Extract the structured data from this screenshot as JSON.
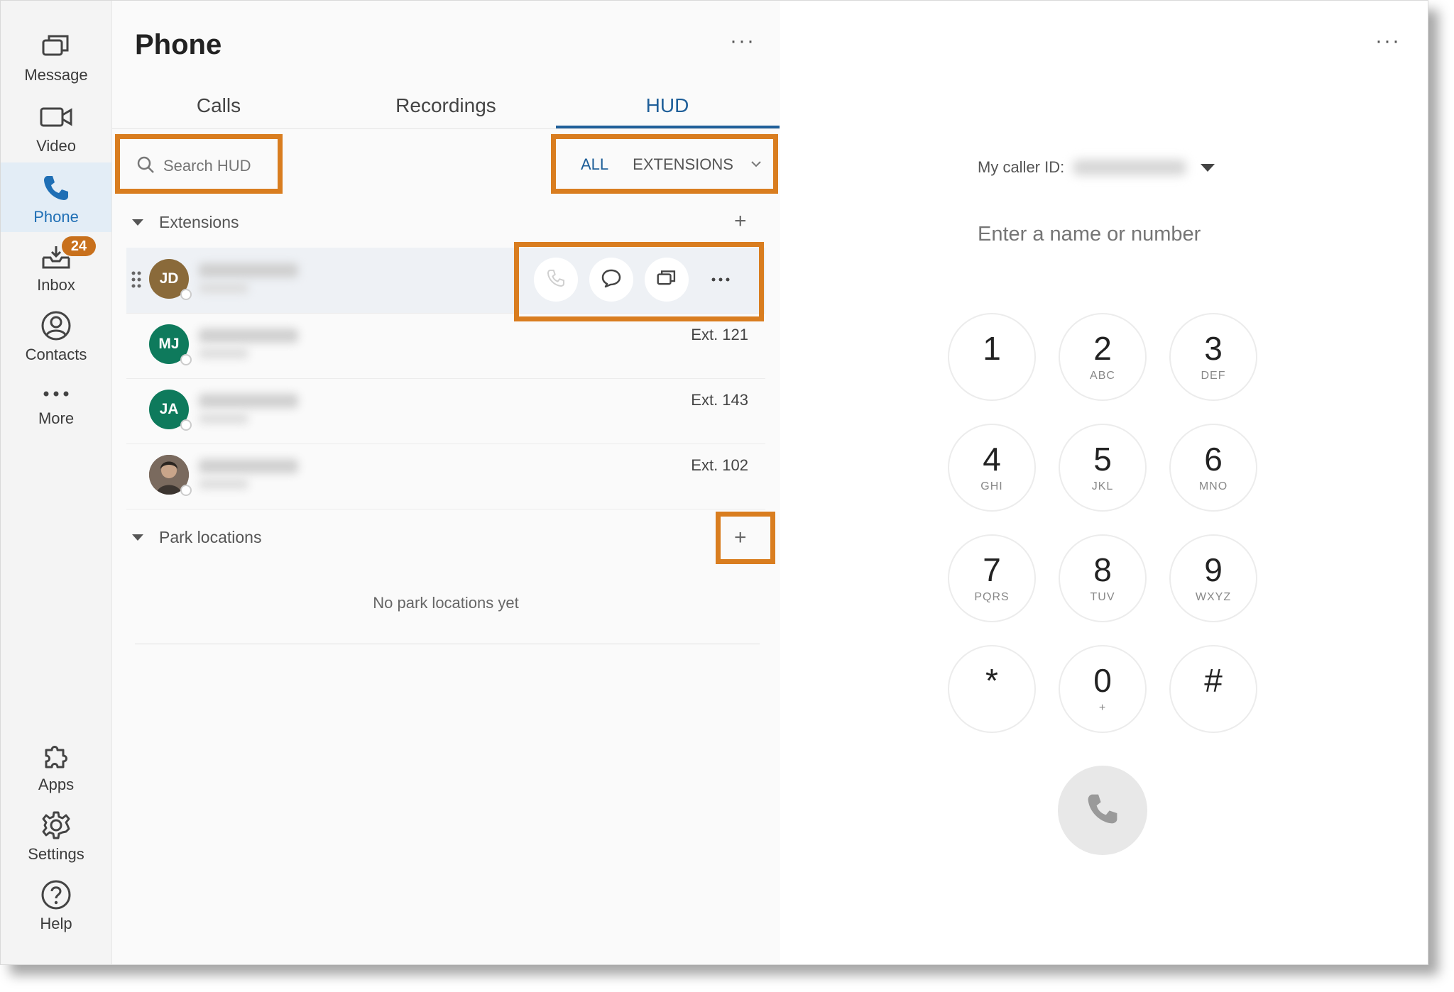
{
  "rail": {
    "items": [
      {
        "label": "Message",
        "icon": "message-icon"
      },
      {
        "label": "Video",
        "icon": "video-icon"
      },
      {
        "label": "Phone",
        "icon": "phone-icon",
        "active": true
      },
      {
        "label": "Inbox",
        "icon": "inbox-icon",
        "badge": "24"
      },
      {
        "label": "Contacts",
        "icon": "contacts-icon"
      },
      {
        "label": "More",
        "icon": "more-dots-icon"
      },
      {
        "label": "Apps",
        "icon": "puzzle-icon"
      },
      {
        "label": "Settings",
        "icon": "gear-icon"
      },
      {
        "label": "Help",
        "icon": "help-icon"
      }
    ]
  },
  "panel": {
    "title": "Phone",
    "more": "···",
    "tabs": [
      {
        "label": "Calls"
      },
      {
        "label": "Recordings"
      },
      {
        "label": "HUD",
        "active": true
      }
    ],
    "search": {
      "placeholder": "Search HUD"
    },
    "filter": {
      "all": "ALL",
      "extensions": "EXTENSIONS"
    },
    "sections": {
      "extensions": {
        "label": "Extensions"
      },
      "park": {
        "label": "Park locations",
        "empty": "No park locations yet"
      }
    },
    "contacts": [
      {
        "initials": "JD",
        "ext": "",
        "color": "#8a6a3a"
      },
      {
        "initials": "MJ",
        "ext": "Ext. 121",
        "color": "#0e7a5c"
      },
      {
        "initials": "JA",
        "ext": "Ext. 143",
        "color": "#0e7a5c"
      },
      {
        "initials": "",
        "ext": "Ext. 102",
        "color": "#6b5a4e"
      }
    ],
    "row_actions": [
      "call-icon",
      "chat-icon",
      "message-icon",
      "more-dots-icon"
    ]
  },
  "dialer": {
    "more": "···",
    "caller_id_label": "My caller ID:",
    "input_placeholder": "Enter a name or number",
    "keys": [
      {
        "digit": "1",
        "letters": ""
      },
      {
        "digit": "2",
        "letters": "ABC"
      },
      {
        "digit": "3",
        "letters": "DEF"
      },
      {
        "digit": "4",
        "letters": "GHI"
      },
      {
        "digit": "5",
        "letters": "JKL"
      },
      {
        "digit": "6",
        "letters": "MNO"
      },
      {
        "digit": "7",
        "letters": "PQRS"
      },
      {
        "digit": "8",
        "letters": "TUV"
      },
      {
        "digit": "9",
        "letters": "WXYZ"
      },
      {
        "digit": "*",
        "letters": ""
      },
      {
        "digit": "0",
        "letters": "+"
      },
      {
        "digit": "#",
        "letters": ""
      }
    ]
  },
  "colors": {
    "accent": "#1f5f99",
    "highlight": "#d97d1f",
    "badge": "#c8701c"
  }
}
